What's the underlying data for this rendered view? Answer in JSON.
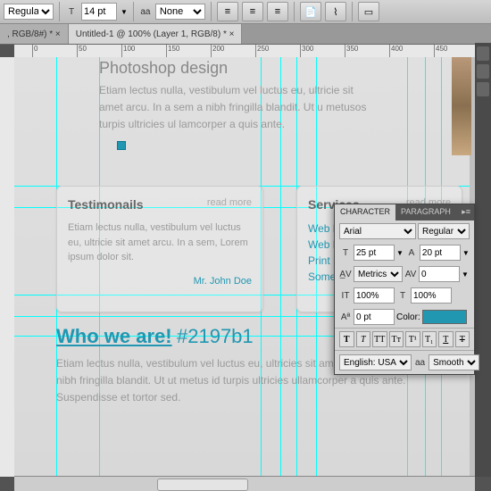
{
  "toolbar": {
    "weight": "Regular",
    "size_label": "T",
    "size": "14 pt",
    "aa_label": "aa",
    "aa": "None"
  },
  "tabs": [
    {
      "label": ", RGB/8#) * ×"
    },
    {
      "label": "Untitled-1 @ 100% (Layer 1, RGB/8) * ×"
    }
  ],
  "ruler_h": [
    "0",
    "50",
    "100",
    "150",
    "200",
    "250",
    "300",
    "350",
    "400",
    "450"
  ],
  "content": {
    "title": "Photoshop design",
    "body": "Etiam lectus nulla, vestibulum vel luctus eu, ultricie sit amet arcu. In a sem a nibh fringilla blandit. Ut u metusos turpis ultricies ul lamcorper a quis ante.",
    "who_title": "Who we are!",
    "hex": "#2197b1",
    "who_body": "Etiam lectus nulla, vestibulum vel luctus eu, ultricies sit amet arcu. In a sem a nibh fringilla blandit. Ut ut metus id turpis ultricies ullamcorper a quis ante. Suspendisse et tortor sed."
  },
  "card1": {
    "title": "Testimonails",
    "more": "read more",
    "body": "Etiam lectus nulla, vestibulum vel luctus eu, ultricie sit amet arcu. In a sem, Lorem ipsum dolor sit.",
    "attrib": "Mr. John Doe"
  },
  "card2": {
    "title": "Services",
    "more": "read more",
    "links": [
      "Web De",
      "Web De",
      "Print De",
      "Some U"
    ]
  },
  "panel": {
    "tab1": "CHARACTER",
    "tab2": "PARAGRAPH",
    "font": "Arial",
    "weight": "Regular",
    "size": "25 pt",
    "leading": "20 pt",
    "kerning": "Metrics",
    "tracking": "0",
    "hscale": "100%",
    "vscale": "100%",
    "baseline": "0 pt",
    "color_label": "Color:",
    "lang": "English: USA",
    "aa_label": "aa",
    "aa": "Smooth"
  }
}
